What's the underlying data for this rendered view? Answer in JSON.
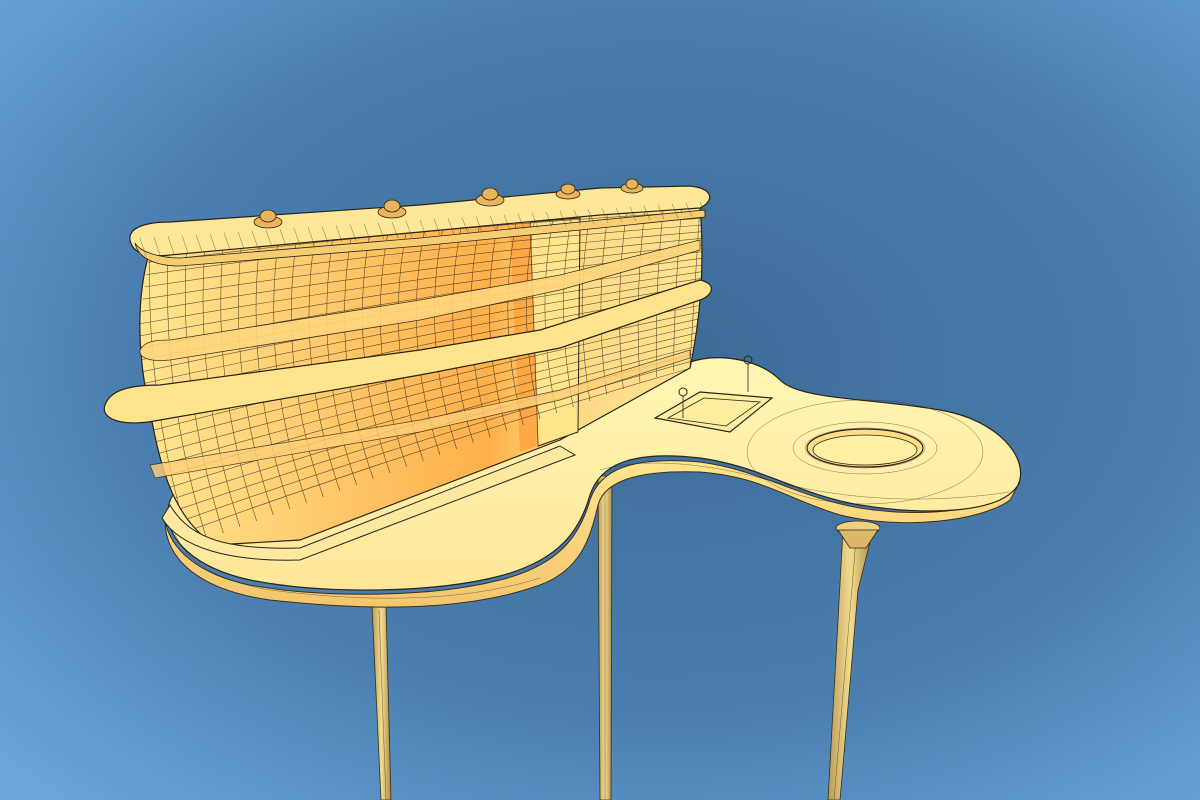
{
  "scene": {
    "subject": "wireframe-render-of-reception-desk",
    "render_mode": "shaded-with-wireframe-overlay",
    "colors": {
      "background_center": "#3f6f9c",
      "background_edge": "#6aa3d8",
      "surface_light": "#fff3a8",
      "surface_mid": "#ffe08a",
      "surface_warm": "#ffb24a",
      "surface_shadow": "#e9a04a",
      "wire": "#2a2418"
    },
    "objects": [
      {
        "name": "curved-cabinet-tower"
      },
      {
        "name": "kidney-counter-slab"
      },
      {
        "name": "round-basin-opening"
      },
      {
        "name": "rectangular-sink-recess"
      },
      {
        "name": "support-pole"
      }
    ]
  }
}
